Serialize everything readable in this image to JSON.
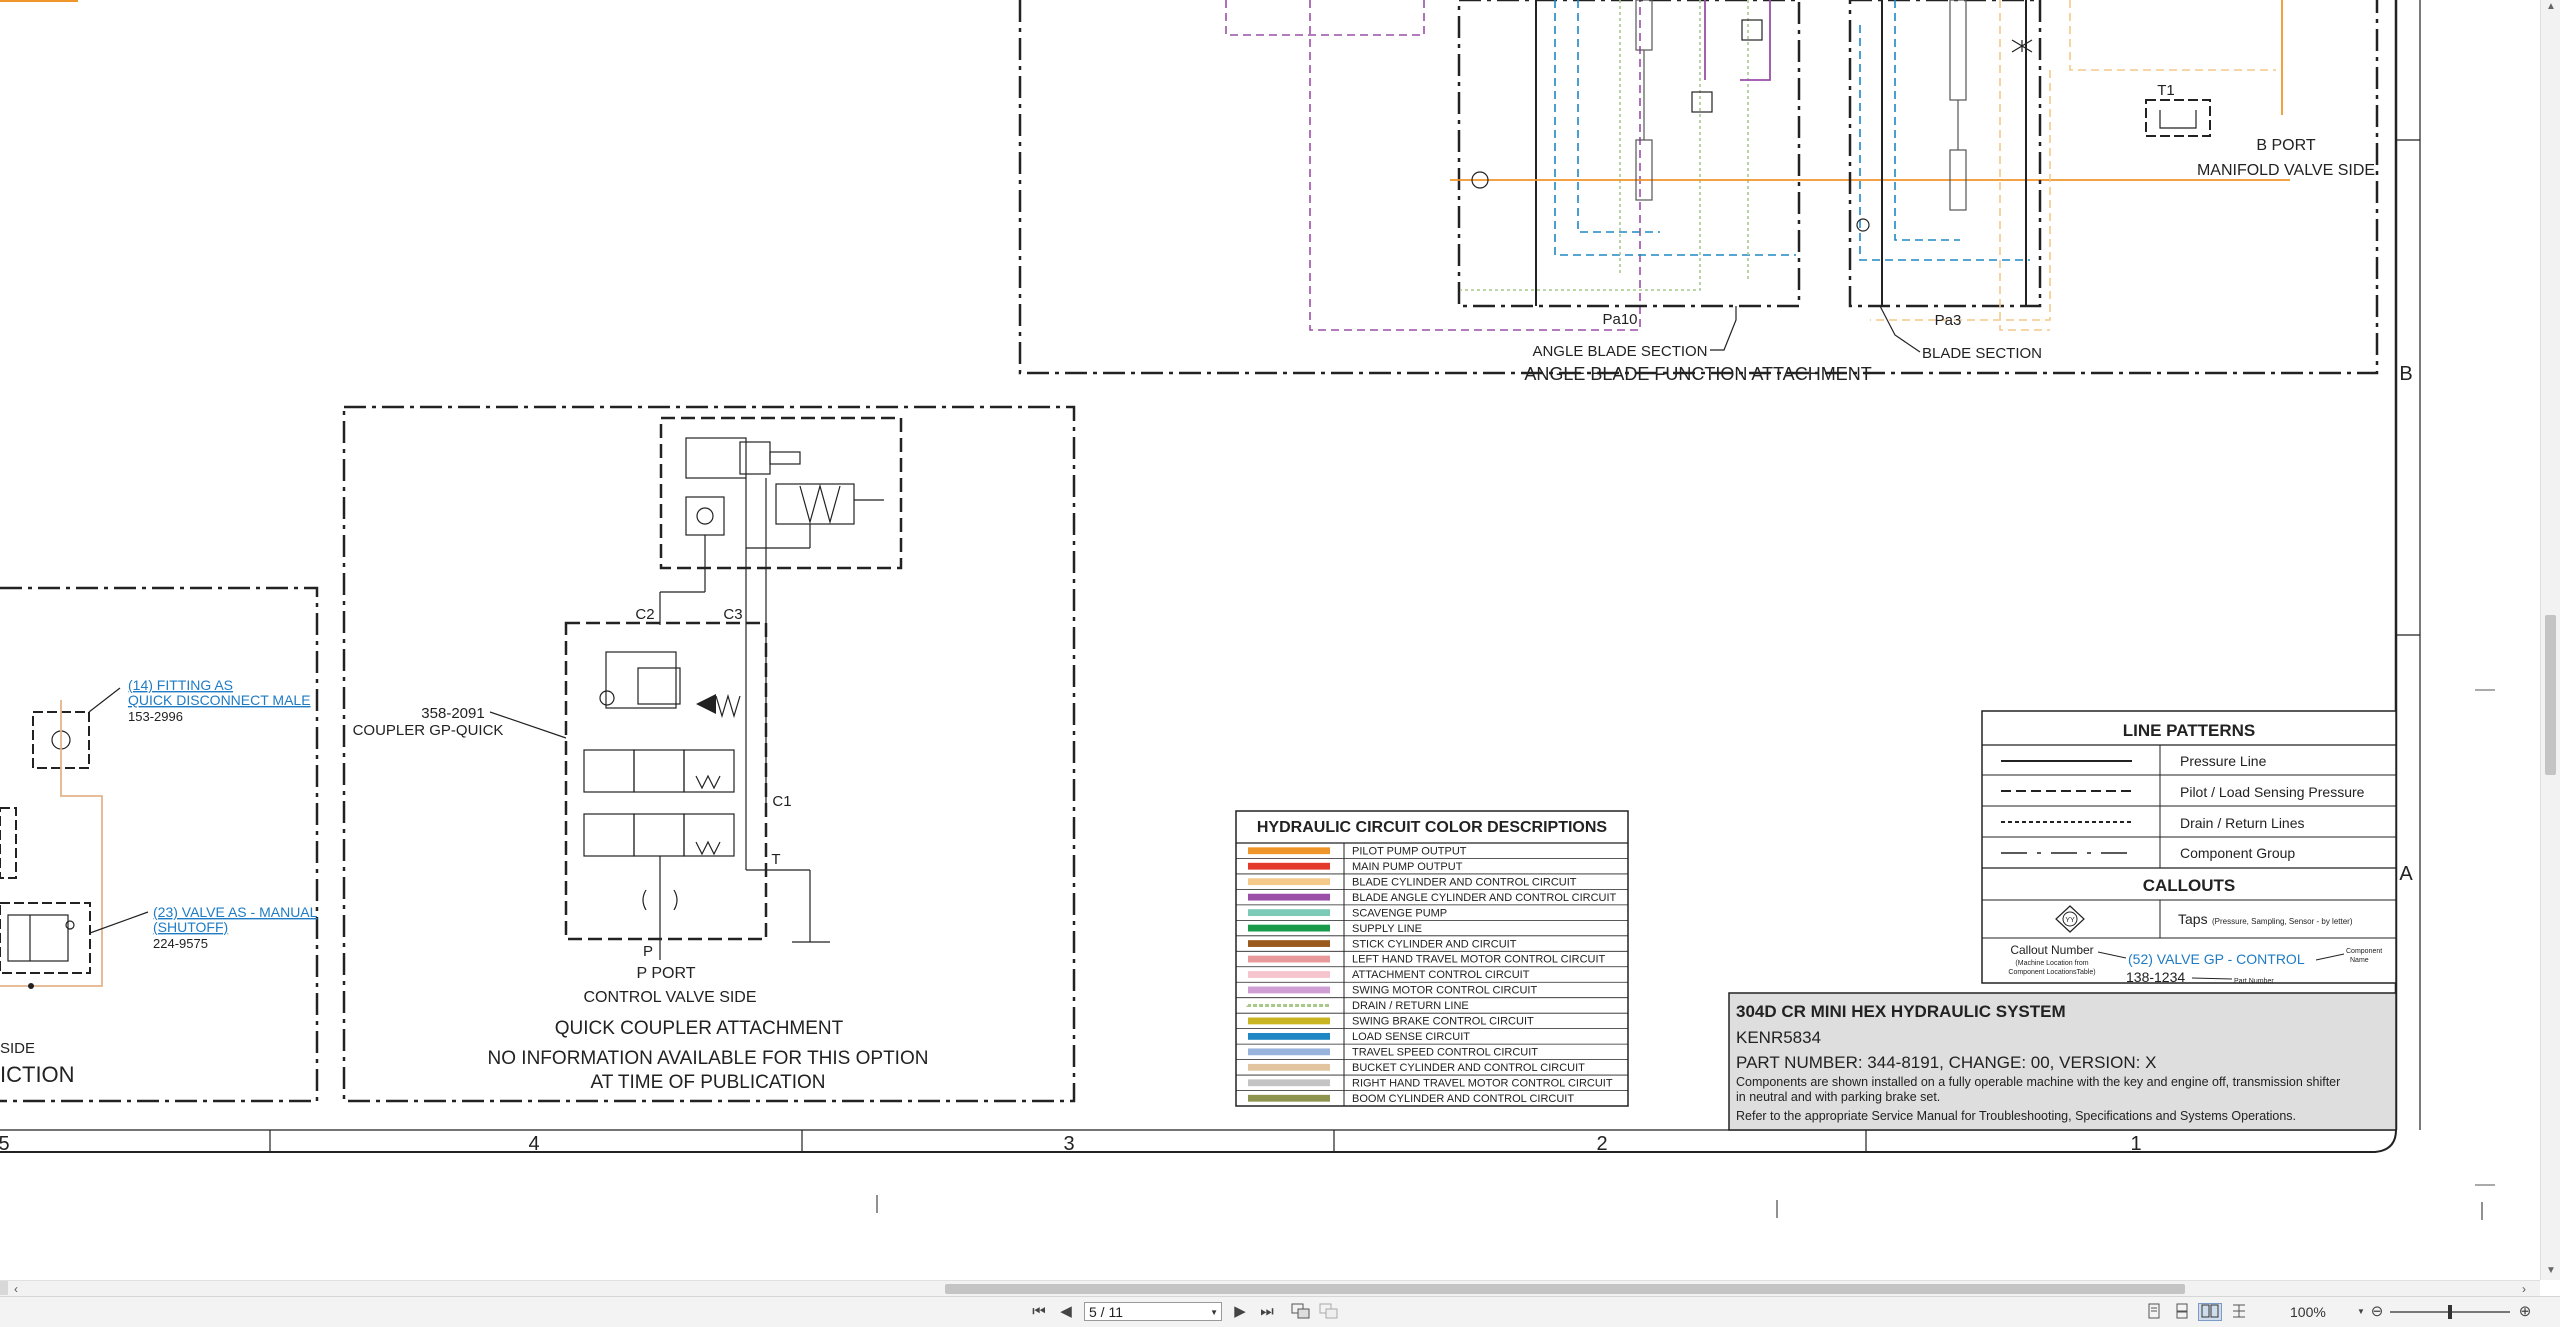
{
  "window": {
    "title": "304D CR MINI HEX HYDRAULIC SYSTEM"
  },
  "schematic": {
    "angle_blade": {
      "pa10": "Pa10",
      "pa3": "Pa3",
      "t1": "T1",
      "angle_section": "ANGLE BLADE SECTION",
      "blade_section": "BLADE SECTION",
      "function_title": "ANGLE BLADE FUNCTION ATTACHMENT",
      "b_port": "B PORT",
      "manifold": "MANIFOLD VALVE SIDE"
    },
    "quick_coupler": {
      "c2": "C2",
      "c3": "C3",
      "c1": "C1",
      "t": "T",
      "p": "P",
      "part_number": "358-2091",
      "part_name": "COUPLER GP-QUICK",
      "p_port": "P PORT",
      "control_valve_side": "CONTROL VALVE SIDE",
      "title": "QUICK COUPLER ATTACHMENT",
      "note_line1": "NO INFORMATION AVAILABLE FOR THIS OPTION",
      "note_line2": "AT TIME OF PUBLICATION"
    },
    "left_section": {
      "fitting_callout": "(14) FITTING AS",
      "fitting_name": "QUICK DISCONNECT MALE",
      "fitting_part": "153-2996",
      "valve_callout": "(23) VALVE AS - MANUAL",
      "valve_name": "(SHUTOFF)",
      "valve_part": "224-9575",
      "side_fragment": "SIDE",
      "function_fragment": "ICTION"
    },
    "zones": {
      "row_b": "B",
      "row_a": "A",
      "col_5": "5",
      "col_4": "4",
      "col_3": "3",
      "col_2": "2",
      "col_1": "1"
    }
  },
  "color_legend": {
    "title": "HYDRAULIC CIRCUIT COLOR DESCRIPTIONS",
    "items": [
      {
        "label": "PILOT PUMP OUTPUT",
        "color": "#f0952a",
        "style": "solid"
      },
      {
        "label": "MAIN PUMP OUTPUT",
        "color": "#e43a2c",
        "style": "solid"
      },
      {
        "label": "BLADE CYLINDER AND CONTROL CIRCUIT",
        "color": "#f4c98a",
        "style": "solid"
      },
      {
        "label": "BLADE ANGLE CYLINDER AND CONTROL CIRCUIT",
        "color": "#9b4fa8",
        "style": "solid"
      },
      {
        "label": "SCAVENGE PUMP",
        "color": "#7cc9b8",
        "style": "solid"
      },
      {
        "label": "SUPPLY LINE",
        "color": "#1a9b4a",
        "style": "solid"
      },
      {
        "label": "STICK CYLINDER AND CIRCUIT",
        "color": "#9a5a1e",
        "style": "solid"
      },
      {
        "label": "LEFT HAND TRAVEL MOTOR CONTROL CIRCUIT",
        "color": "#e89a9a",
        "style": "solid"
      },
      {
        "label": "ATTACHMENT CONTROL CIRCUIT",
        "color": "#f6c4cc",
        "style": "solid"
      },
      {
        "label": "SWING MOTOR CONTROL CIRCUIT",
        "color": "#cf9ed4",
        "style": "solid"
      },
      {
        "label": "DRAIN / RETURN LINE",
        "color": "#a6c98a",
        "style": "dotted"
      },
      {
        "label": "SWING BRAKE CONTROL CIRCUIT",
        "color": "#c9b522",
        "style": "solid"
      },
      {
        "label": "LOAD SENSE CIRCUIT",
        "color": "#1e87c4",
        "style": "solid"
      },
      {
        "label": "TRAVEL SPEED CONTROL CIRCUIT",
        "color": "#98b4dc",
        "style": "solid"
      },
      {
        "label": "BUCKET CYLINDER AND CONTROL CIRCUIT",
        "color": "#e3c4a0",
        "style": "solid"
      },
      {
        "label": "RIGHT HAND TRAVEL MOTOR CONTROL CIRCUIT",
        "color": "#c4c4c4",
        "style": "solid"
      },
      {
        "label": "BOOM CYLINDER AND CONTROL CIRCUIT",
        "color": "#8e9450",
        "style": "solid"
      }
    ]
  },
  "line_patterns": {
    "title": "LINE PATTERNS",
    "items": [
      {
        "label": "Pressure Line",
        "style": "solid"
      },
      {
        "label": "Pilot / Load Sensing Pressure",
        "style": "dashed"
      },
      {
        "label": "Drain / Return Lines",
        "style": "dotted"
      },
      {
        "label": "Component Group",
        "style": "dashdot"
      }
    ],
    "callouts_title": "CALLOUTS",
    "taps_label": "Taps",
    "taps_note": "(Pressure, Sampling, Sensor - by letter)",
    "tap_symbol": "YY",
    "callout_number": "Callout Number",
    "callout_number_note1": "(Machine Location from",
    "callout_number_note2": "Component LocationsTable)",
    "example_callout": "(52) VALVE GP - CONTROL",
    "example_part": "138-1234",
    "component_name_1": "Component",
    "component_name_2": "Name",
    "part_number_label": "Part Number"
  },
  "title_block": {
    "title": "304D CR MINI HEX HYDRAULIC SYSTEM",
    "doc_id": "KENR5834",
    "part_line": "PART NUMBER: 344-8191, CHANGE: 00, VERSION: X",
    "note1": "Components are shown installed on a fully operable machine with the key and engine off, transmission shifter",
    "note2": "in neutral and with parking brake set.",
    "note3": "Refer to the appropriate Service Manual for Troubleshooting, Specifications and Systems Operations."
  },
  "toolbar": {
    "first": "⏮",
    "prev": "◀",
    "page_value": "5 / 11",
    "next": "▶",
    "last": "⏭",
    "zoom": "100%",
    "zoom_out": "⊖",
    "zoom_in": "⊕"
  }
}
